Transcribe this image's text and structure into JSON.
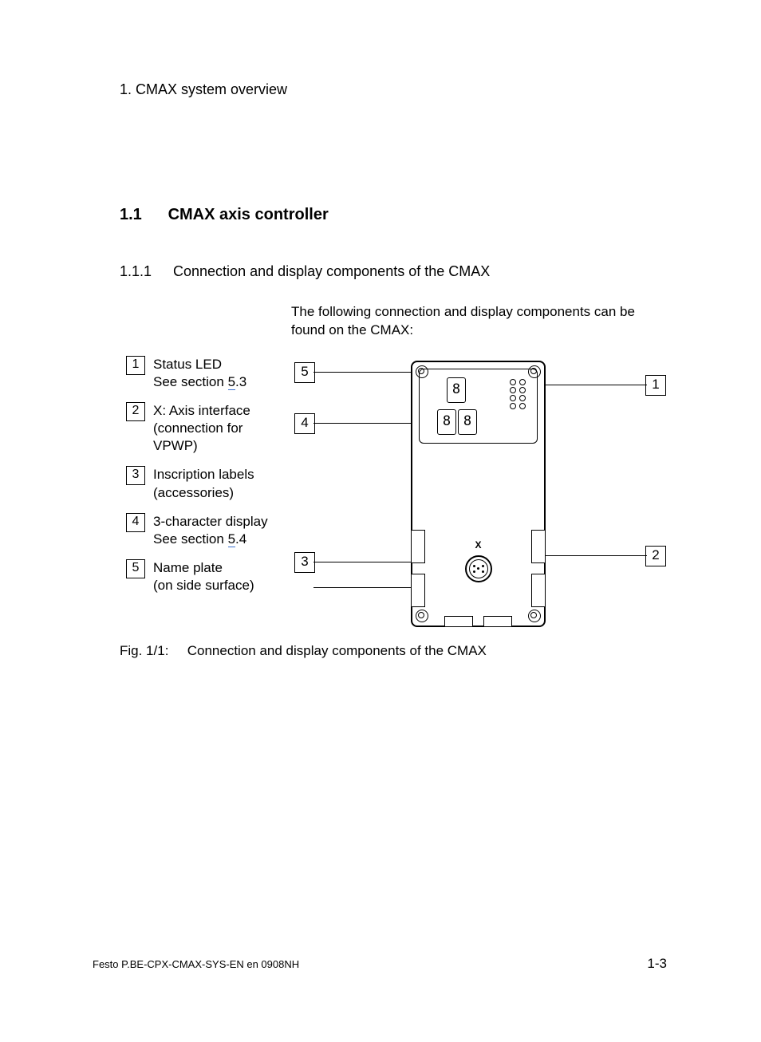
{
  "chapter_header": "1.   CMAX system overview",
  "section": {
    "num": "1.1",
    "title": "CMAX axis controller"
  },
  "subsection": {
    "num": "1.1.1",
    "title": "Connection and display components of the CMAX"
  },
  "intro": "The following connection and display components can be found on the CMAX:",
  "legend": [
    {
      "n": "1",
      "text_a": "Status LED",
      "text_b_pre": "See section ",
      "xref": "5",
      "text_b_post": ".3"
    },
    {
      "n": "2",
      "text_a": "X: Axis interface (connection for VPWP)"
    },
    {
      "n": "3",
      "text_a": "Inscription labels (accessories)"
    },
    {
      "n": "4",
      "text_a": "3-character display",
      "text_b_pre": "See section ",
      "xref": "5",
      "text_b_post": ".4"
    },
    {
      "n": "5",
      "text_a": "Name plate",
      "text_b_plain": "(on side surface)"
    }
  ],
  "callouts_left": [
    {
      "n": "5"
    },
    {
      "n": "4"
    },
    {
      "n": "3"
    }
  ],
  "callouts_right": [
    {
      "n": "1"
    },
    {
      "n": "2"
    }
  ],
  "device_labels": {
    "seg": "8",
    "x": "X"
  },
  "caption": {
    "fignum": "Fig. 1/1:",
    "text": "Connection and display components of the CMAX"
  },
  "footer_left": "Festo P.BE-CPX-CMAX-SYS-EN  en 0908NH",
  "footer_right": "1-3"
}
